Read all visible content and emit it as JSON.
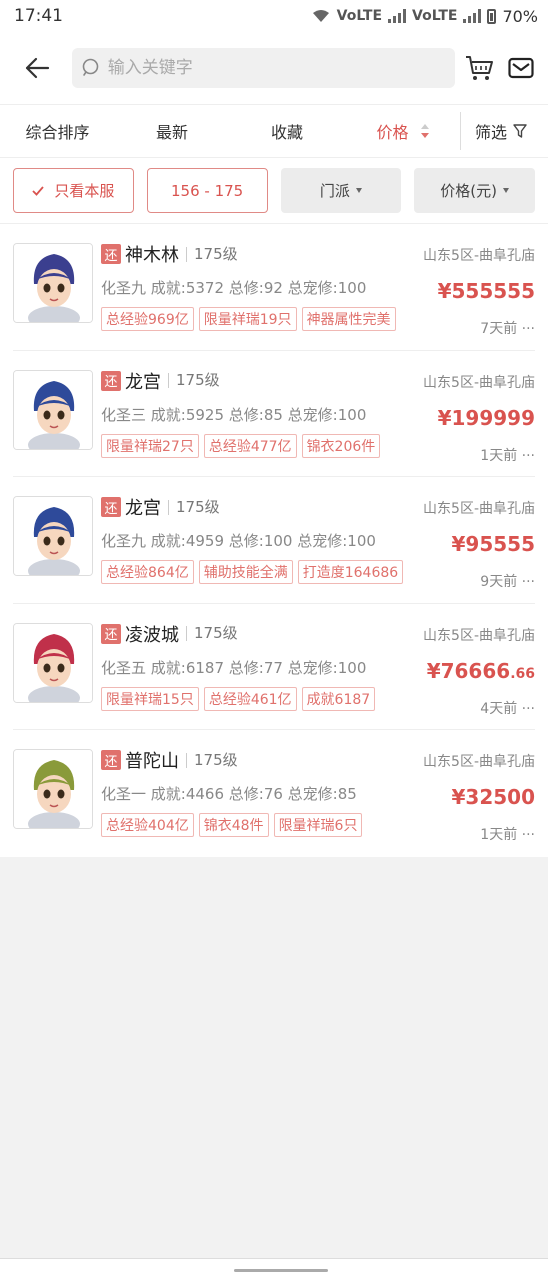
{
  "status_bar": {
    "time": "17:41",
    "network1": "VoLTE",
    "network2": "VoLTE",
    "battery": "70%"
  },
  "header": {
    "search_placeholder": "输入关键字"
  },
  "sort_bar": {
    "items": [
      "综合排序",
      "最新",
      "收藏",
      "价格"
    ],
    "active": "价格",
    "filter_label": "筛选"
  },
  "filters": {
    "own_server": "只看本服",
    "level_range": "156 - 175",
    "school": "门派",
    "price": "价格(元)"
  },
  "listings": [
    {
      "badge": "还",
      "name": "神木林",
      "level": "175级",
      "server": "山东5区-曲阜孔庙",
      "stats": "化圣九 成就:5372 总修:92 总宠修:100",
      "price_main": "¥555555",
      "price_dec": "",
      "tags": [
        "总经验969亿",
        "限量祥瑞19只",
        "神器属性完美"
      ],
      "time": "7天前 ···",
      "avatar_color": "#3b3f8f"
    },
    {
      "badge": "还",
      "name": "龙宫",
      "level": "175级",
      "server": "山东5区-曲阜孔庙",
      "stats": "化圣三 成就:5925 总修:85 总宠修:100",
      "price_main": "¥199999",
      "price_dec": "",
      "tags": [
        "限量祥瑞27只",
        "总经验477亿",
        "锦衣206件"
      ],
      "time": "1天前 ···",
      "avatar_color": "#2e4a9a"
    },
    {
      "badge": "还",
      "name": "龙宫",
      "level": "175级",
      "server": "山东5区-曲阜孔庙",
      "stats": "化圣九 成就:4959 总修:100 总宠修:100",
      "price_main": "¥95555",
      "price_dec": "",
      "tags": [
        "总经验864亿",
        "辅助技能全满",
        "打造度164686"
      ],
      "time": "9天前 ···",
      "avatar_color": "#2e4a9a"
    },
    {
      "badge": "还",
      "name": "凌波城",
      "level": "175级",
      "server": "山东5区-曲阜孔庙",
      "stats": "化圣五 成就:6187 总修:77 总宠修:100",
      "price_main": "¥76666",
      "price_dec": ".66",
      "tags": [
        "限量祥瑞15只",
        "总经验461亿",
        "成就6187"
      ],
      "time": "4天前 ···",
      "avatar_color": "#c0304a"
    },
    {
      "badge": "还",
      "name": "普陀山",
      "level": "175级",
      "server": "山东5区-曲阜孔庙",
      "stats": "化圣一 成就:4466 总修:76 总宠修:85",
      "price_main": "¥32500",
      "price_dec": "",
      "tags": [
        "总经验404亿",
        "锦衣48件",
        "限量祥瑞6只"
      ],
      "time": "1天前 ···",
      "avatar_color": "#8a9a3a"
    }
  ]
}
